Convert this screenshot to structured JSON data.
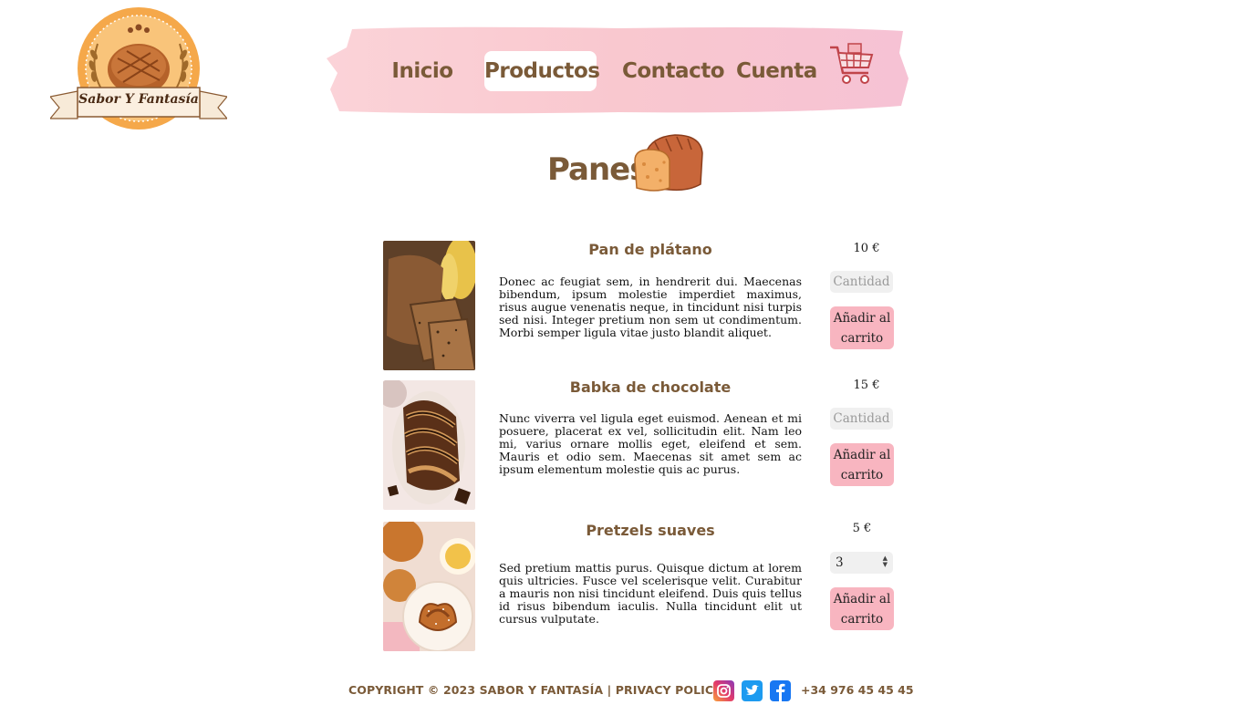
{
  "brand": {
    "name": "Sabor Y Fantasía",
    "colors": {
      "primary_text": "#7a5a38",
      "button": "#f8b5c0",
      "nav_brush": "#f7c6cf",
      "logo_orange": "#f5a84a"
    }
  },
  "nav": {
    "items": [
      {
        "label": "Inicio",
        "active": false
      },
      {
        "label": "Productos",
        "active": true
      },
      {
        "label": "Contacto",
        "active": false
      },
      {
        "label": "Cuenta",
        "active": false
      }
    ],
    "cart_icon": "shopping-cart-icon"
  },
  "section": {
    "title": "Panes",
    "icon": "bread-loaf-icon"
  },
  "products": [
    {
      "name": "Pan de plátano",
      "price": "10 €",
      "description": "Donec ac feugiat sem, in hendrerit dui. Maecenas bibendum, ipsum molestie imperdiet maximus, risus augue venenatis neque, in tincidunt nisi turpis sed nisi. Integer pretium non sem ut condimentum. Morbi semper ligula vitae justo blandit aliquet.",
      "quantity_placeholder": "Cantidad",
      "quantity_value": "",
      "button_label": "Añadir al carrito"
    },
    {
      "name": "Babka de chocolate",
      "price": "15 €",
      "description": "Nunc viverra vel ligula eget euismod. Aenean et mi posuere, placerat ex vel, sollicitudin elit. Nam leo mi, varius ornare mollis eget, eleifend et sem. Mauris et odio sem. Maecenas sit amet sem ac ipsum elementum molestie quis ac purus.",
      "quantity_placeholder": "Cantidad",
      "quantity_value": "",
      "button_label": "Añadir al carrito"
    },
    {
      "name": "Pretzels suaves",
      "price": "5 €",
      "description": "Sed pretium mattis purus. Quisque dictum at lorem quis ultricies. Fusce vel scelerisque velit. Curabitur a mauris non nisi tincidunt eleifend. Duis quis tellus id risus bibendum iaculis. Nulla tincidunt elit ut cursus vulputate.",
      "quantity_placeholder": "Cantidad",
      "quantity_value": "3",
      "button_label": "Añadir al carrito"
    }
  ],
  "footer": {
    "copyright": "COPYRIGHT © 2023 SABOR Y FANTASÍA |",
    "privacy_label": "PRIVACY POLICY",
    "social": [
      "instagram-icon",
      "twitter-icon",
      "facebook-icon"
    ],
    "phone": "+34 976 45 45 45"
  }
}
